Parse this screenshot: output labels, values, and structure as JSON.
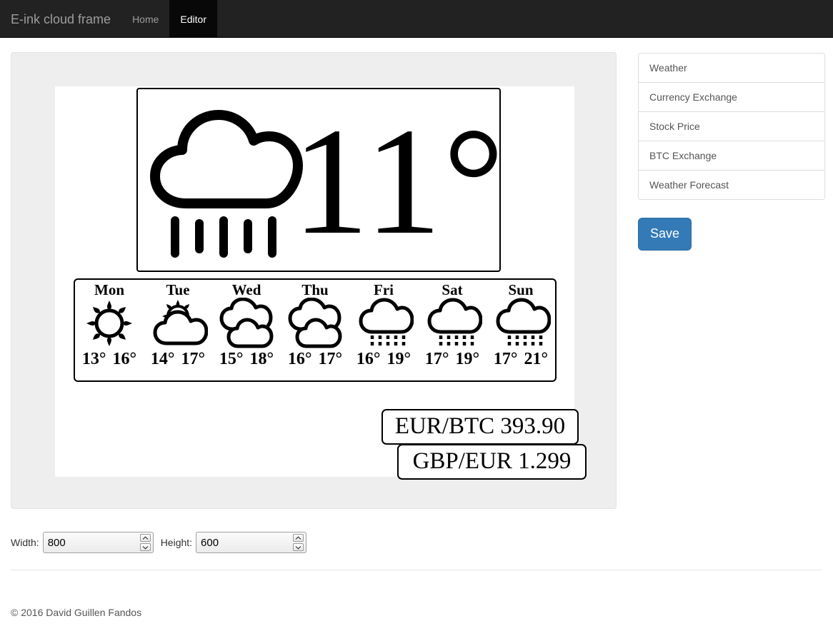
{
  "navbar": {
    "brand": "E-ink cloud frame",
    "items": [
      {
        "label": "Home",
        "active": false
      },
      {
        "label": "Editor",
        "active": true
      }
    ]
  },
  "sidebar": {
    "widgets": [
      {
        "label": "Weather"
      },
      {
        "label": "Currency Exchange"
      },
      {
        "label": "Stock Price"
      },
      {
        "label": "BTC Exchange"
      },
      {
        "label": "Weather Forecast"
      }
    ],
    "save_label": "Save"
  },
  "preview": {
    "weather_widget": {
      "icon": "cloud-rain-icon",
      "temperature": "11°"
    },
    "forecast_widget": {
      "days": [
        {
          "name": "Mon",
          "icon": "sun-icon",
          "low": "13°",
          "high": "16°"
        },
        {
          "name": "Tue",
          "icon": "sun-cloud-icon",
          "low": "14°",
          "high": "17°"
        },
        {
          "name": "Wed",
          "icon": "double-cloud-icon",
          "low": "15°",
          "high": "18°"
        },
        {
          "name": "Thu",
          "icon": "double-cloud-icon",
          "low": "16°",
          "high": "17°"
        },
        {
          "name": "Fri",
          "icon": "cloud-rain-icon",
          "low": "16°",
          "high": "19°"
        },
        {
          "name": "Sat",
          "icon": "cloud-rain-icon",
          "low": "17°",
          "high": "19°"
        },
        {
          "name": "Sun",
          "icon": "cloud-rain-icon",
          "low": "17°",
          "high": "21°"
        }
      ]
    },
    "currency_widgets": [
      {
        "label": "EUR/BTC 393.90"
      },
      {
        "label": "GBP/EUR 1.299"
      }
    ]
  },
  "controls": {
    "width_label": "Width:",
    "width_value": "800",
    "height_label": "Height:",
    "height_value": "600"
  },
  "footer": {
    "copyright": "© 2016 David Guillen Fandos"
  },
  "colors": {
    "navbar_bg": "#222222",
    "navbar_active_bg": "#080808",
    "brand_text": "#9d9d9d",
    "well_bg": "#eeeeee",
    "canvas_bg": "#ffffff",
    "primary": "#337ab7",
    "list_border": "#dddddd"
  }
}
